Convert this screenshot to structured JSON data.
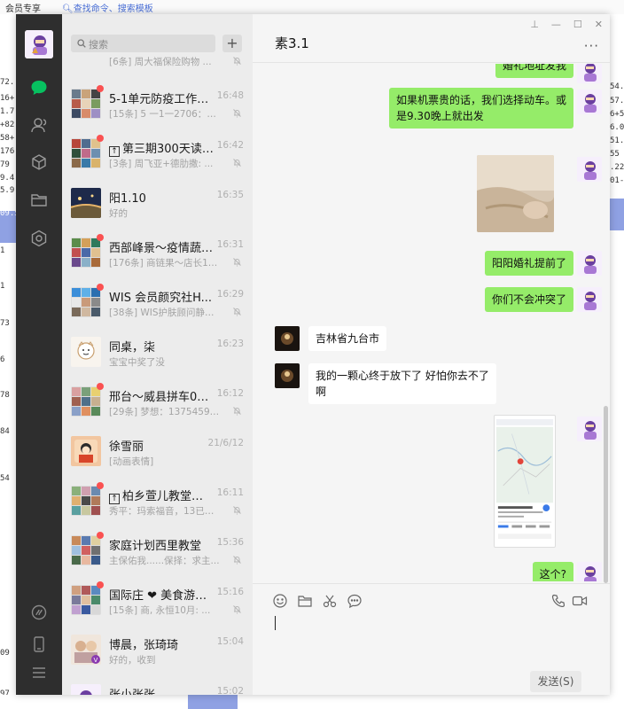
{
  "background_app": {
    "member_label": "会员专享",
    "command_search": "查找命令、搜索模板",
    "left_numbers": [
      "72.",
      "16+",
      "1.7",
      "+82",
      "58+",
      "176",
      "79",
      "9.4",
      "5.9",
      "09.5",
      "1",
      "1",
      "73",
      "6",
      "78",
      "84",
      "54",
      "09",
      "97"
    ],
    "right_numbers": [
      "54.",
      "57.",
      "6+5",
      "6.0",
      "51.",
      "55",
      ".22",
      "01-"
    ]
  },
  "nav": {
    "items": [
      "chat",
      "contacts",
      "favorites",
      "files",
      "mini-programs"
    ],
    "bottom_items": [
      "moments",
      "phone",
      "menu"
    ]
  },
  "search": {
    "placeholder": "搜索"
  },
  "conversations": [
    {
      "name": "",
      "preview": "[6条] 周大福保险购物 ...",
      "time": "",
      "muted": true,
      "unread_dot": false
    },
    {
      "name": "5-1单元防疫工作业...",
      "preview": "[15条] 5 一1一2706：不...",
      "time": "16:48",
      "muted": true,
      "unread_dot": true
    },
    {
      "name": "第三期300天读 ...",
      "preview": "[3条] 周飞亚+德肋撒: ...",
      "time": "16:42",
      "muted": true,
      "unread_dot": true,
      "pinned_icon": "↑"
    },
    {
      "name": "阳1.10",
      "preview": "好的",
      "time": "16:35",
      "muted": false,
      "unread_dot": false
    },
    {
      "name": "西部峰景～疫情蔬菜...",
      "preview": "[176条] 商链果～店长19...",
      "time": "16:31",
      "muted": true,
      "unread_dot": true
    },
    {
      "name": "WIS 会员颜究社H...",
      "preview": "[38条] WIS护肤顾问静琪...",
      "time": "16:29",
      "muted": true,
      "unread_dot": true
    },
    {
      "name": "同桌，柒",
      "preview": "宝宝中奖了没",
      "time": "16:23",
      "muted": false,
      "unread_dot": false
    },
    {
      "name": "邢台～威县拼车0319...",
      "preview": "[29条] 梦想：13754592...",
      "time": "16:12",
      "muted": true,
      "unread_dot": true
    },
    {
      "name": "徐雪丽",
      "preview": "[动画表情]",
      "time": "21/6/12",
      "muted": false,
      "unread_dot": false
    },
    {
      "name": "柏乡萱儿教堂片 ...",
      "preview": "秀平：玛索福音，13已读...",
      "time": "16:11",
      "muted": true,
      "unread_dot": true,
      "pinned_icon": "↑"
    },
    {
      "name": "家庭计划西里教堂",
      "preview": "主保佑我......保择：求主...",
      "time": "15:36",
      "muted": true,
      "unread_dot": true
    },
    {
      "name": "国际庄 ❤ 美食游玩...",
      "preview": "[15条] 商, 永恒10月: ...",
      "time": "15:16",
      "muted": true,
      "unread_dot": true
    },
    {
      "name": "博晨，张琦琦",
      "preview": "好的，收到",
      "time": "15:04",
      "muted": false,
      "unread_dot": false
    },
    {
      "name": "张小张张",
      "preview": "",
      "time": "15:02",
      "muted": false,
      "unread_dot": false
    }
  ],
  "chat": {
    "title": "素3.1",
    "window_controls": {
      "pin": "⊥",
      "minimize": "—",
      "maximize": "☐",
      "close": "✕"
    },
    "more": "···",
    "messages": [
      {
        "side": "out",
        "type": "text",
        "lines": [
          "婚礼地址发我"
        ]
      },
      {
        "side": "out",
        "type": "text",
        "lines": [
          "如果机票贵的话，我们选择动车。或",
          "是9.30晚上就出发"
        ]
      },
      {
        "side": "out",
        "type": "image",
        "label": "photo"
      },
      {
        "side": "out",
        "type": "text",
        "lines": [
          "阳阳婚礼提前了"
        ]
      },
      {
        "side": "out",
        "type": "text",
        "lines": [
          "你们不会冲突了"
        ]
      },
      {
        "side": "in",
        "type": "text",
        "lines": [
          "吉林省九台市"
        ]
      },
      {
        "side": "in",
        "type": "text",
        "lines": [
          "我的一颗心终于放下了 好怕你去不了",
          "啊"
        ]
      },
      {
        "side": "out",
        "type": "image",
        "label": "map-screenshot"
      },
      {
        "side": "out",
        "type": "text",
        "lines": [
          "这个?"
        ]
      }
    ],
    "send_label": "发送(S)"
  },
  "colors": {
    "rail": "#2e2e2e",
    "list_bg": "#ececec",
    "chat_bg": "#f5f5f5",
    "bubble_out": "#95ec69",
    "bubble_in": "#ffffff",
    "unread": "#fa5151",
    "accent": "#07c160"
  }
}
